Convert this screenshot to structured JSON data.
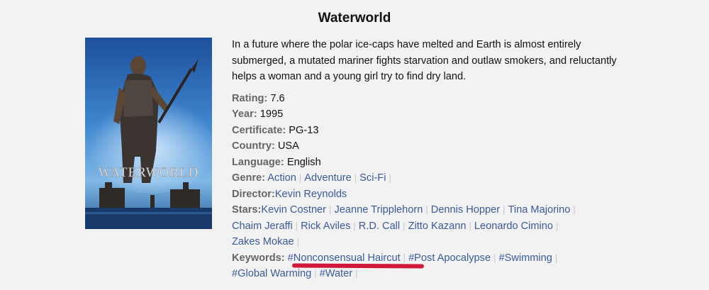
{
  "movie": {
    "title": "Waterworld",
    "poster_text": "WATERWORLD",
    "synopsis": "In a future where the polar ice-caps have melted and Earth is almost entirely submerged, a mutated mariner fights starvation and outlaw smokers, and reluctantly helps a woman and a young girl try to find dry land.",
    "rating_label": "Rating:",
    "rating": "7.6",
    "year_label": "Year:",
    "year": "1995",
    "certificate_label": "Certificate:",
    "certificate": "PG-13",
    "country_label": "Country:",
    "country": "USA",
    "language_label": "Language:",
    "language": "English",
    "genre_label": "Genre:",
    "genres": [
      "Action",
      "Adventure",
      "Sci-Fi"
    ],
    "director_label": "Director:",
    "director": "Kevin Reynolds",
    "stars_label": "Stars:",
    "stars": [
      "Kevin Costner",
      "Jeanne Tripplehorn",
      "Dennis Hopper",
      "Tina Majorino",
      "Chaim Jeraffi",
      "Rick Aviles",
      "R.D. Call",
      "Zitto Kazann",
      "Leonardo Cimino",
      "Zakes Mokae"
    ],
    "keywords_label": "Keywords:",
    "keywords": [
      "#Nonconsensual Haircut",
      "#Post Apocalypse",
      "#Swimming",
      "#Global Warming",
      "#Water"
    ],
    "separator": "|"
  },
  "colors": {
    "link": "#3a5a9a",
    "label": "#666666",
    "highlight_underline": "#d0193a",
    "background": "#f2f2f2"
  }
}
